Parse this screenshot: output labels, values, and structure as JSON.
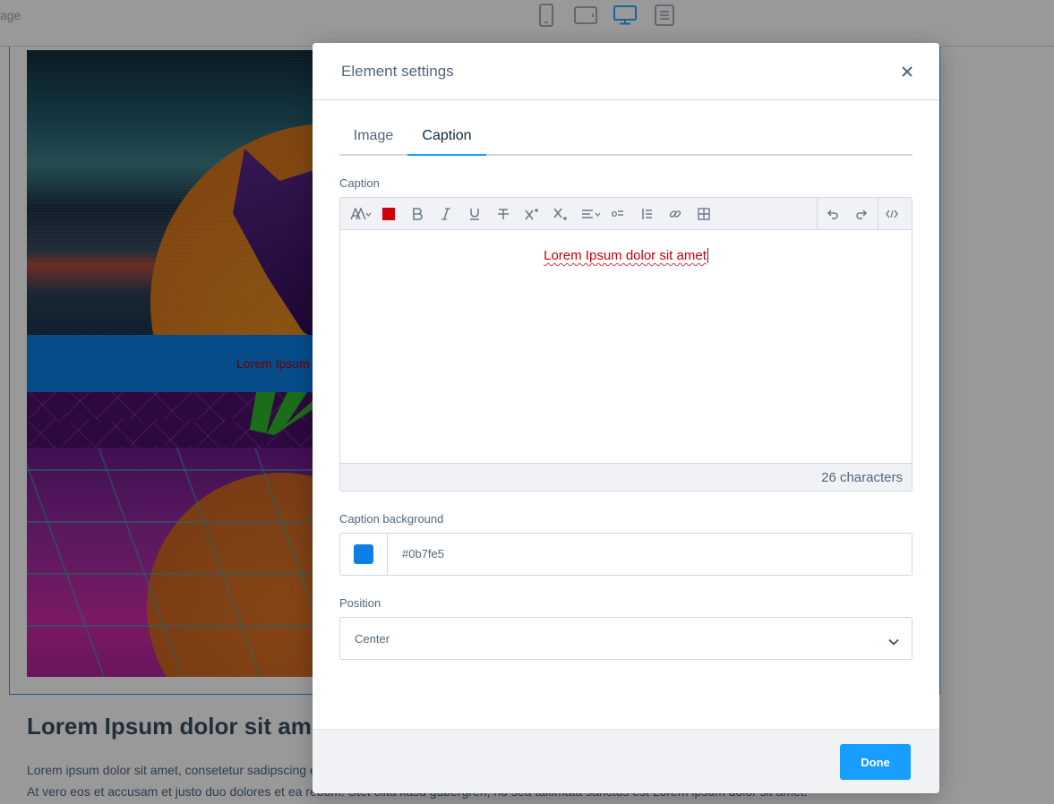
{
  "topbar": {
    "crumb": "age",
    "devices": [
      {
        "name": "mobile-view-icon"
      },
      {
        "name": "tablet-view-icon"
      },
      {
        "name": "desktop-view-icon",
        "active": true
      },
      {
        "name": "list-view-icon"
      }
    ]
  },
  "content": {
    "image_caption": "Lorem Ipsum",
    "heading": "Lorem Ipsum dolor sit amet",
    "paragraph": "Lorem ipsum dolor sit amet, consetetur sadipscing elitr, sed diam nonumy eirmod tempor invidunt ut labore et dolore magna aliquyam erat, sed diam voluptua. At vero eos et accusam et justo duo dolores et ea rebum. Stet clita kasd gubergren, no sea takimata sanctus est Lorem ipsum dolor sit amet."
  },
  "modal": {
    "title": "Element settings",
    "close_icon": "close-icon",
    "tabs": [
      {
        "label": "Image",
        "active": false
      },
      {
        "label": "Caption",
        "active": true
      }
    ],
    "caption_label": "Caption",
    "editor": {
      "toolbar_icons": [
        "text-style-icon",
        "text-color-icon",
        "bold-icon",
        "italic-icon",
        "underline-icon",
        "strikethrough-icon",
        "superscript-icon",
        "subscript-icon",
        "align-icon",
        "bullet-list-icon",
        "numbered-list-icon",
        "link-icon",
        "table-icon",
        "undo-icon",
        "redo-icon",
        "code-view-icon"
      ],
      "text_color": "#d0000a",
      "text": "Lorem Ipsum dolor sit amet",
      "char_count": "26 characters"
    },
    "caption_background_label": "Caption background",
    "caption_background": {
      "color": "#0b7fe5",
      "value": "#0b7fe5"
    },
    "position_label": "Position",
    "position_value": "Center",
    "done_label": "Done"
  },
  "colors": {
    "accent": "#189eff",
    "caption_background": "#0b7fe5"
  }
}
